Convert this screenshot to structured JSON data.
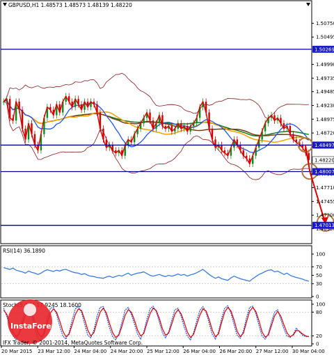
{
  "chart_data": [
    {
      "type": "candlestick",
      "symbol_line": "GBPUSD,H1  1.48573 1.48573 1.48139 1.48220",
      "ylim": [
        1.467,
        1.51
      ],
      "y_ticks": [
        "1.50750",
        "1.50495",
        "1.49990",
        "1.49735",
        "1.49485",
        "1.49230",
        "1.48975",
        "1.48720",
        "1.48465",
        "1.48220",
        "1.47960",
        "1.47710",
        "1.47455",
        "1.47200",
        "1.46950"
      ],
      "x_ticks": [
        "20 Mar 2015",
        "23 Mar 12:00",
        "24 Mar 04:00",
        "24 Mar 20:00",
        "25 Mar 12:00",
        "26 Mar 04:00",
        "26 Mar 20:00",
        "27 Mar 12:00",
        "30 Mar 04:00"
      ],
      "levels": [
        {
          "label": "1.50269",
          "value": 1.50269
        },
        {
          "label": "1.48497",
          "value": 1.48497
        },
        {
          "label": "1.48007",
          "value": 1.48007
        },
        {
          "label": "1.47013",
          "value": 1.47013
        }
      ],
      "current_price_label": "1.48220",
      "close": [
        1.493,
        1.4935,
        1.49,
        1.4895,
        1.493,
        1.4915,
        1.488,
        1.486,
        1.489,
        1.487,
        1.485,
        1.484,
        1.487,
        1.49,
        1.492,
        1.4915,
        1.4905,
        1.4925,
        1.491,
        1.493,
        1.494,
        1.493,
        1.492,
        1.4935,
        1.4925,
        1.4915,
        1.493,
        1.492,
        1.493,
        1.4925,
        1.491,
        1.488,
        1.486,
        1.4845,
        1.485,
        1.484,
        1.4835,
        1.484,
        1.483,
        1.485,
        1.486,
        1.4855,
        1.487,
        1.488,
        1.489,
        1.49,
        1.491,
        1.4895,
        1.488,
        1.489,
        1.4905,
        1.4885,
        1.488,
        1.4885,
        1.4875,
        1.488,
        1.489,
        1.488,
        1.4885,
        1.4875,
        1.4885,
        1.489,
        1.49,
        1.492,
        1.493,
        1.491,
        1.488,
        1.486,
        1.4845,
        1.485,
        1.484,
        1.4835,
        1.483,
        1.4845,
        1.486,
        1.485,
        1.484,
        1.483,
        1.4825,
        1.4815,
        1.483,
        1.4845,
        1.486,
        1.4875,
        1.489,
        1.49,
        1.4905,
        1.4895,
        1.49,
        1.489,
        1.488,
        1.4885,
        1.487,
        1.486,
        1.4855,
        1.485,
        1.4845,
        1.4835,
        1.4822
      ],
      "forecast": [
        [
          1.485,
          1.4801
        ],
        [
          1.4801,
          1.4701
        ]
      ]
    },
    {
      "type": "line",
      "label": "RSI(14) 36.1890",
      "ylim": [
        0,
        100
      ],
      "y_ticks": [
        "100",
        "70",
        "50",
        "30",
        "0"
      ],
      "values": [
        68,
        66,
        64,
        67,
        62,
        60,
        58,
        55,
        60,
        57,
        55,
        52,
        55,
        60,
        63,
        61,
        59,
        62,
        60,
        63,
        64,
        61,
        58,
        56,
        55,
        52,
        54,
        50,
        48,
        47,
        45,
        44,
        43,
        46,
        48,
        45,
        47,
        50,
        48,
        52,
        55,
        50,
        53,
        55,
        56,
        58,
        54,
        50,
        48,
        50,
        52,
        49,
        47,
        50,
        48,
        50,
        53,
        50,
        52,
        48,
        51,
        53,
        56,
        60,
        64,
        58,
        52,
        47,
        43,
        46,
        42,
        40,
        38,
        44,
        48,
        45,
        42,
        40,
        38,
        36,
        42,
        47,
        52,
        55,
        59,
        62,
        63,
        58,
        60,
        56,
        52,
        55,
        50,
        47,
        45,
        43,
        41,
        38,
        36
      ]
    },
    {
      "type": "line",
      "label": "Stoch(5,3,3) 17.9245 18.1600",
      "ylim": [
        0,
        100
      ],
      "y_ticks": [
        "100",
        "80",
        "20",
        "0"
      ],
      "series": [
        {
          "name": "main",
          "values": [
            90,
            70,
            40,
            20,
            10,
            30,
            60,
            85,
            90,
            70,
            40,
            15,
            10,
            30,
            65,
            90,
            92,
            75,
            45,
            20,
            12,
            28,
            60,
            88,
            95,
            80,
            50,
            22,
            15,
            35,
            70,
            92,
            94,
            70,
            40,
            18,
            10,
            25,
            55,
            85,
            92,
            75,
            50,
            25,
            12,
            30,
            62,
            88,
            95,
            82,
            55,
            28,
            15,
            30,
            60,
            86,
            90,
            70,
            42,
            20,
            10,
            28,
            58,
            84,
            94,
            80,
            52,
            24,
            12,
            30,
            64,
            90,
            96,
            78,
            48,
            22,
            14,
            32,
            66,
            92,
            95,
            76,
            46,
            20,
            12,
            26,
            55,
            80,
            86,
            62,
            38,
            20,
            16,
            24,
            40,
            30,
            22,
            18,
            18
          ]
        },
        {
          "name": "signal",
          "values": [
            85,
            75,
            50,
            30,
            18,
            25,
            50,
            72,
            85,
            78,
            55,
            28,
            18,
            25,
            52,
            78,
            88,
            80,
            58,
            32,
            18,
            24,
            48,
            74,
            88,
            84,
            62,
            35,
            20,
            28,
            56,
            80,
            90,
            78,
            52,
            28,
            16,
            22,
            45,
            72,
            86,
            80,
            60,
            35,
            20,
            26,
            52,
            76,
            90,
            84,
            64,
            38,
            22,
            27,
            50,
            75,
            86,
            76,
            54,
            30,
            16,
            24,
            48,
            72,
            88,
            83,
            62,
            35,
            18,
            25,
            54,
            80,
            92,
            83,
            60,
            32,
            18,
            27,
            55,
            82,
            92,
            82,
            58,
            30,
            17,
            22,
            46,
            70,
            82,
            70,
            48,
            28,
            18,
            22,
            34,
            32,
            25,
            20,
            18
          ]
        }
      ]
    }
  ],
  "watermark": {
    "brand": "InstaForex",
    "copyright": "IFX Trader, © 2001-2014, MetaQuotes Software Corp."
  }
}
